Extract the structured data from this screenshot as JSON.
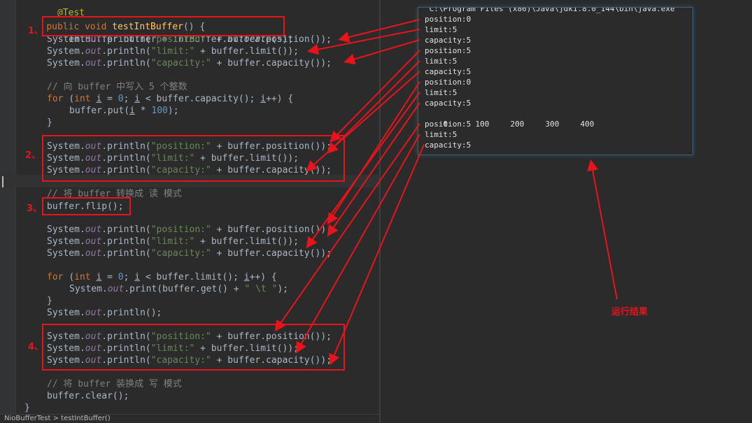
{
  "editor": {
    "lines": [
      {
        "a": "@Test",
        "b": "  @Test"
      },
      {
        "kw": "public void ",
        "meth": "testIntBuffer",
        "rest": "() {"
      },
      {
        "text": "IntBuffer buffer = IntBuffer.",
        "it": "allocate",
        "num": "5",
        "end": ");"
      },
      {
        "p1": "System.",
        "f": "out",
        "p2": ".println(",
        "s": "\"position:\"",
        "p3": " + buffer.position());"
      },
      {
        "p1": "System.",
        "f": "out",
        "p2": ".println(",
        "s": "\"limit:\"",
        "p3": " + buffer.limit());"
      },
      {
        "p1": "System.",
        "f": "out",
        "p2": ".println(",
        "s": "\"capacity:\"",
        "p3": " + buffer.capacity());"
      },
      {
        "cmt": "// 向 buffer 中写入 5 个整数"
      },
      {
        "kw": "for ",
        "a": "(",
        "kw2": "int ",
        "v": "i",
        "b": " = ",
        "n": "0",
        "c": "; ",
        "v2": "i",
        "d": " < buffer.capacity(); ",
        "v3": "i",
        "e": "++) {"
      },
      {
        "a": "buffer.put(",
        "v": "i",
        "b": " * ",
        "n": "100",
        "c": ");"
      },
      {
        "text": "}"
      },
      {
        "p1": "System.",
        "f": "out",
        "p2": ".println(",
        "s": "\"position:\"",
        "p3": " + buffer.position());"
      },
      {
        "p1": "System.",
        "f": "out",
        "p2": ".println(",
        "s": "\"limit:\"",
        "p3": " + buffer.limit());"
      },
      {
        "p1": "System.",
        "f": "out",
        "p2": ".println(",
        "s": "\"capacity:\"",
        "p3": " + buffer.capacity());"
      },
      {
        "cmt": "// 将 buffer 转换成 读 模式"
      },
      {
        "text": "buffer.flip();"
      },
      {
        "p1": "System.",
        "f": "out",
        "p2": ".println(",
        "s": "\"position:\"",
        "p3": " + buffer.position());"
      },
      {
        "p1": "System.",
        "f": "out",
        "p2": ".println(",
        "s": "\"limit:\"",
        "p3": " + buffer.limit());"
      },
      {
        "p1": "System.",
        "f": "out",
        "p2": ".println(",
        "s": "\"capacity:\"",
        "p3": " + buffer.capacity());"
      },
      {
        "kw": "for ",
        "a": "(",
        "kw2": "int ",
        "v": "i",
        "b": " = ",
        "n": "0",
        "c": "; ",
        "v2": "i",
        "d": " < buffer.limit(); ",
        "v3": "i",
        "e": "++) {"
      },
      {
        "p1": "System.",
        "f": "out",
        "p2": ".print(buffer.get() + ",
        "s": "\" \\t \"",
        "p3": ");"
      },
      {
        "text": "}"
      },
      {
        "p1": "System.",
        "f": "out",
        "p2": ".println();"
      },
      {
        "p1": "System.",
        "f": "out",
        "p2": ".println(",
        "s": "\"position:\"",
        "p3": " + buffer.position());"
      },
      {
        "p1": "System.",
        "f": "out",
        "p2": ".println(",
        "s": "\"limit:\"",
        "p3": " + buffer.limit());"
      },
      {
        "p1": "System.",
        "f": "out",
        "p2": ".println(",
        "s": "\"capacity:\"",
        "p3": " + buffer.capacity());"
      },
      {
        "cmt": "// 将 buffer 装换成 写 模式"
      },
      {
        "text": "buffer.clear();"
      },
      {
        "text": "}"
      }
    ],
    "bottom_text": "NioBufferTest > testIntBuffer()"
  },
  "console": {
    "header": "\"C:\\Program Files (x86)\\Java\\jdk1.8.0_144\\bin\\java.exe\"",
    "lines": [
      "position:0",
      "limit:5",
      "capacity:5",
      "position:5",
      "limit:5",
      "capacity:5",
      "position:0",
      "limit:5",
      "capacity:5",
      "",
      "position:5",
      "limit:5",
      "capacity:5"
    ],
    "values_row": [
      "0",
      "100",
      "200",
      "300",
      "400"
    ]
  },
  "markers": [
    "1、",
    "2、",
    "3、",
    "4、"
  ],
  "result_label": "运行结果",
  "colors": {
    "annotation_red": "#e8141a",
    "console_border": "#3e5f7a"
  }
}
